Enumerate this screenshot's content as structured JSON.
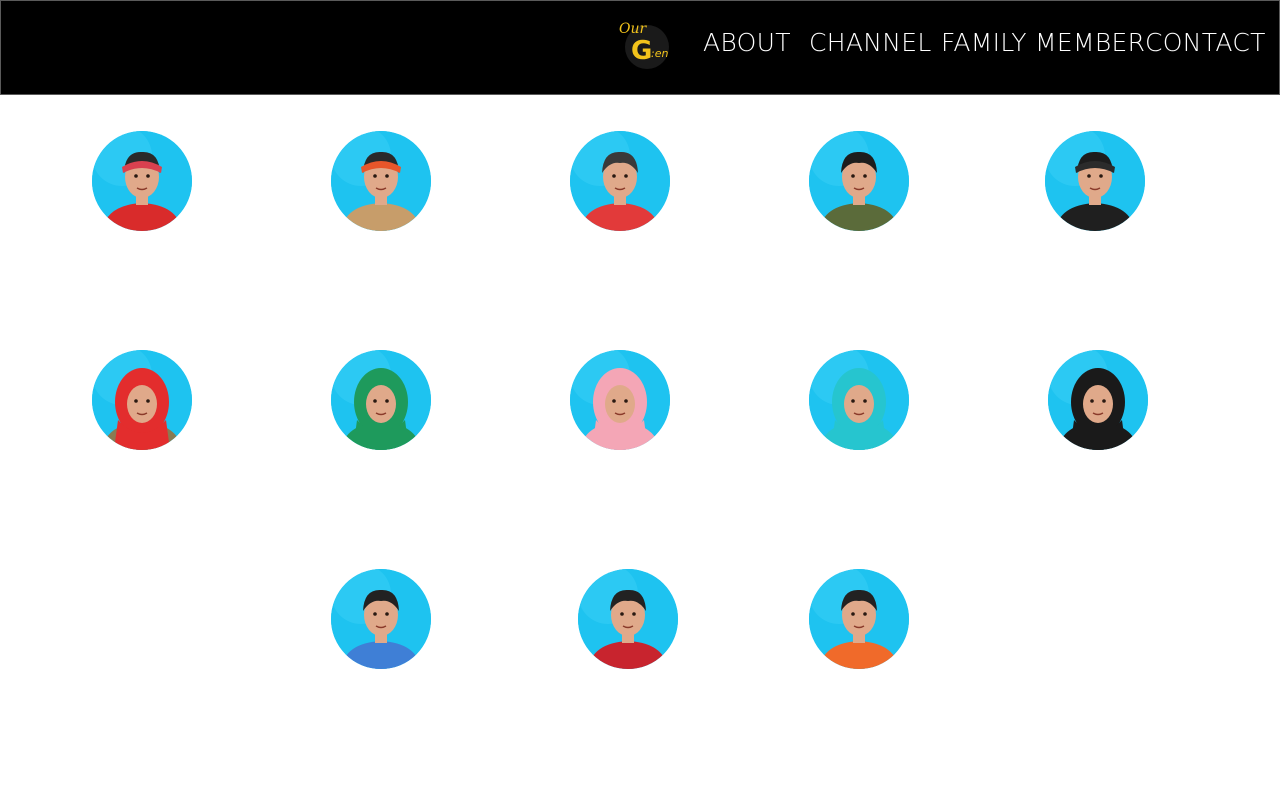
{
  "header": {
    "logo": {
      "icon": "our-gen-logo",
      "text_top": "Our",
      "text_main": "G",
      "text_tail": ":en",
      "color": "#f2c31b"
    },
    "nav": [
      {
        "label": "ABOUT"
      },
      {
        "label": "CHANNEL"
      },
      {
        "label": "FAMILY MEMBER"
      },
      {
        "label": "CONTACT"
      }
    ]
  },
  "colors": {
    "header_bg": "#000000",
    "nav_text": "#ffffff",
    "avatar_bg": "#1ec3f0",
    "page_bg": "#ffffff"
  },
  "members": [
    {
      "icon": "man-red-bandana-avatar",
      "hair": "#2a2a2a",
      "headwear": "#d9414f",
      "shirt": "#d92b2b"
    },
    {
      "icon": "woman-orange-turban-avatar",
      "hair": "#2a2a2a",
      "headwear": "#e8562a",
      "shirt": "#c79d6a"
    },
    {
      "icon": "boy-white-glasses-avatar",
      "hair": "#3a3a3a",
      "headwear": "none",
      "shirt": "#e23a3a"
    },
    {
      "icon": "young-man-camo-jacket-avatar",
      "hair": "#1d1d1d",
      "headwear": "none",
      "shirt": "#5b6b3a"
    },
    {
      "icon": "man-black-bandana-avatar",
      "hair": "#1d1d1d",
      "headwear": "#2b2b2b",
      "shirt": "#1f1f1f"
    },
    {
      "icon": "girl-red-hijab-avatar",
      "hair": "none",
      "headwear": "#e32d2d",
      "shirt": "#8a7a52"
    },
    {
      "icon": "girl-green-hijab-glasses-avatar",
      "hair": "none",
      "headwear": "#1e9a5c",
      "shirt": "#1e9a5c"
    },
    {
      "icon": "girl-pink-hijab-avatar",
      "hair": "none",
      "headwear": "#f4a6b6",
      "shirt": "#f4a6b6"
    },
    {
      "icon": "girl-teal-hijab-avatar",
      "hair": "none",
      "headwear": "#26c5cf",
      "shirt": "#26c5cf"
    },
    {
      "icon": "woman-black-hijab-heart-glasses-avatar",
      "hair": "none",
      "headwear": "#1a1a1a",
      "shirt": "#1a1a1a"
    },
    {
      "icon": "boy-blue-hoodie-avatar",
      "hair": "#222222",
      "headwear": "none",
      "shirt": "#3f7fd6"
    },
    {
      "icon": "boy-red-shirt-avatar",
      "hair": "#222222",
      "headwear": "none",
      "shirt": "#c8242e"
    },
    {
      "icon": "little-boy-orange-shirt-avatar",
      "hair": "#222222",
      "headwear": "none",
      "shirt": "#f06a2a"
    }
  ]
}
